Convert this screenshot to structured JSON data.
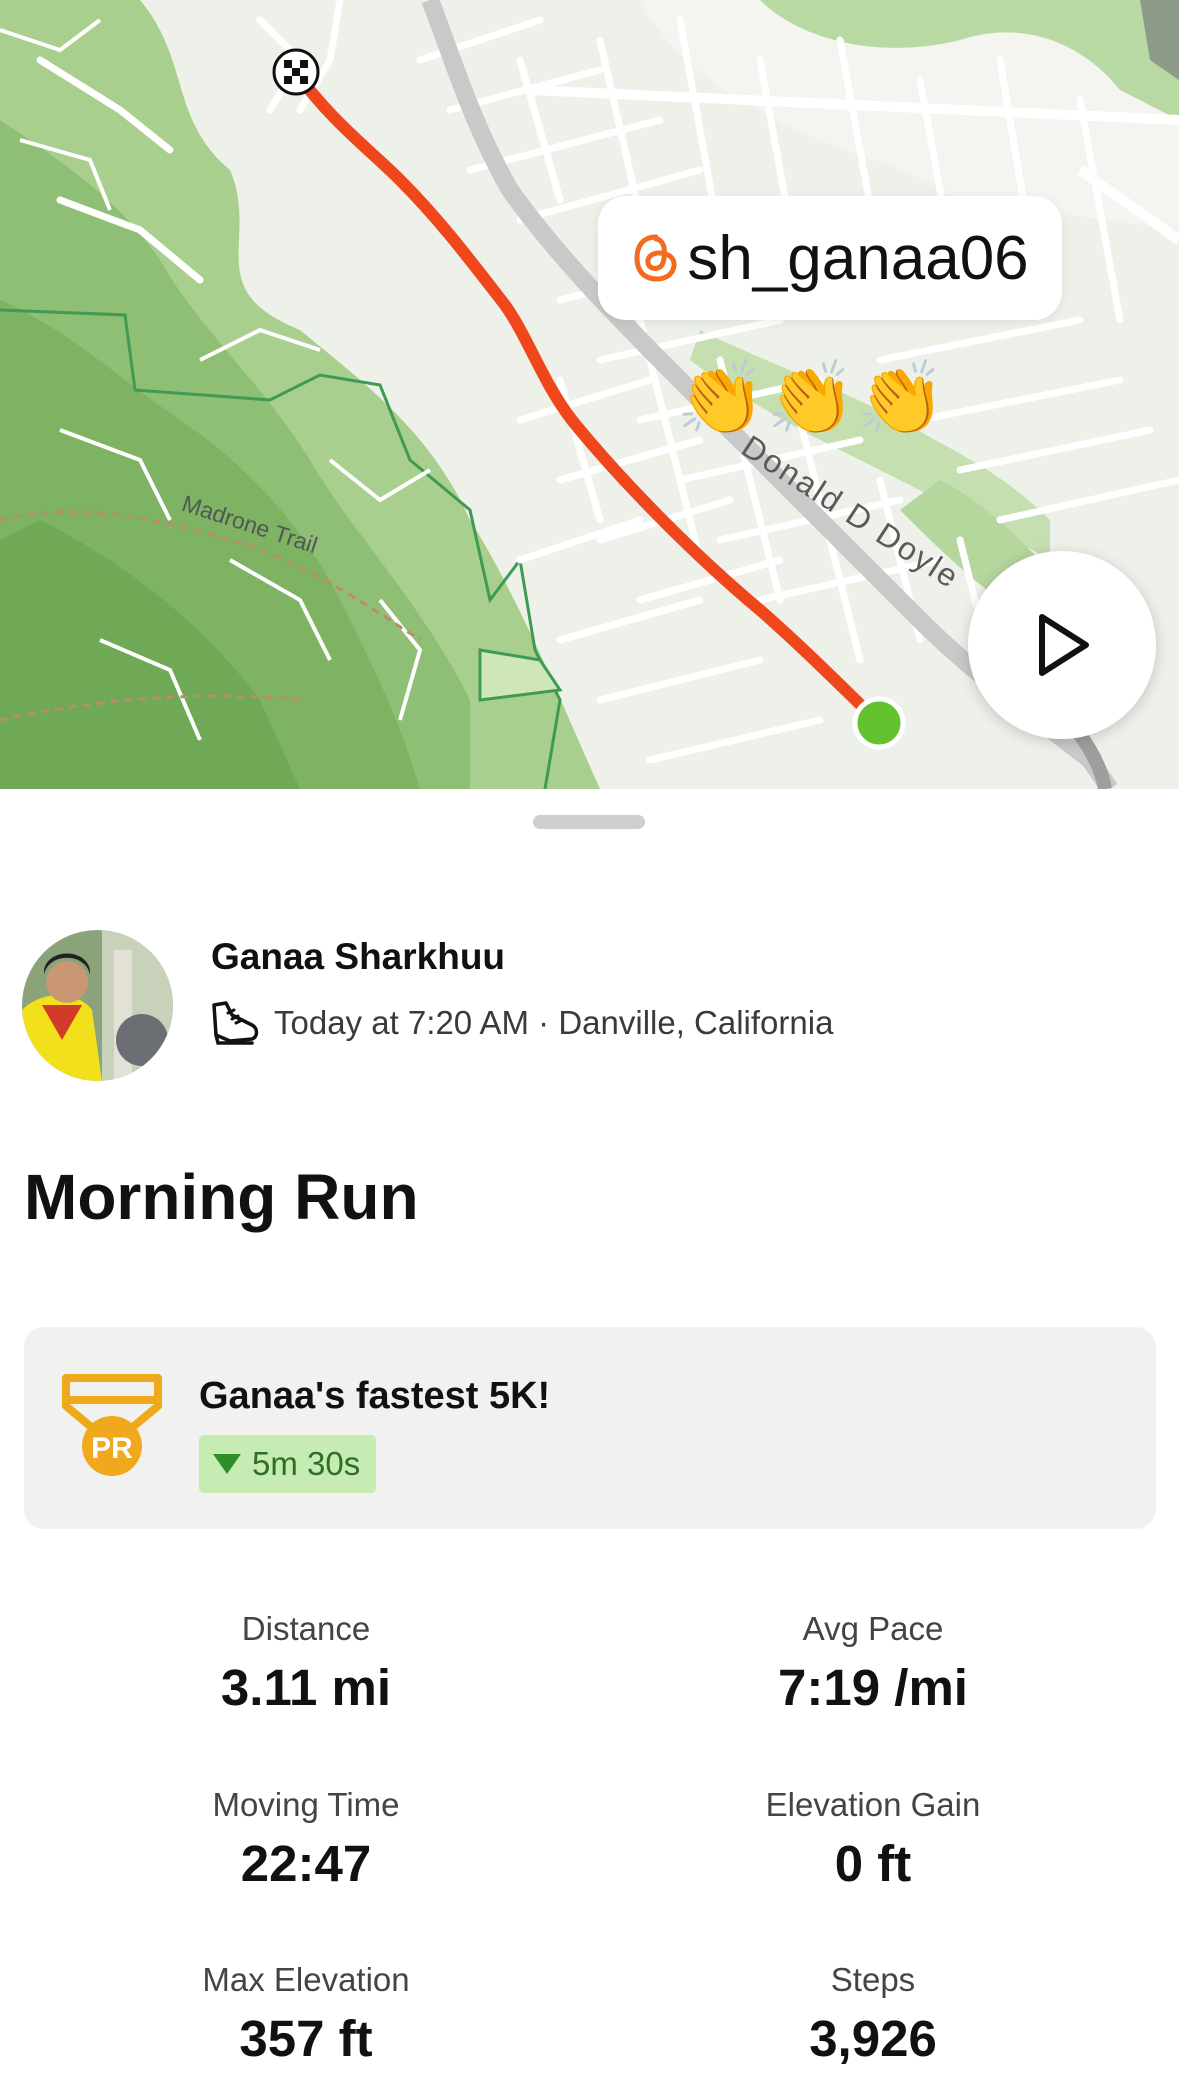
{
  "map": {
    "watermark_handle": "sh_ganaa06",
    "road_label": "Donald D Doyle",
    "trail_label": "Madrone Trail",
    "clap_emoji": "👏",
    "route_color": "#f0461c",
    "start_color": "#63c22d",
    "icons": {
      "finish": "checkered-flag-icon",
      "start": "green-dot-icon",
      "play": "play-icon",
      "watermark": "threads-icon"
    }
  },
  "athlete": {
    "name": "Ganaa Sharkhuu",
    "meta": "Today at 7:20 AM · Danville, California",
    "activity_icon": "running-shoe-icon"
  },
  "activity": {
    "title": "Morning Run"
  },
  "achievement": {
    "icon": "pr-medal-icon",
    "icon_text": "PR",
    "title": "Ganaa's fastest 5K!",
    "delta": "5m 30s",
    "delta_icon": "down-triangle-icon"
  },
  "stats": [
    {
      "label": "Distance",
      "value": "3.11 mi"
    },
    {
      "label": "Avg Pace",
      "value": "7:19 /mi"
    },
    {
      "label": "Moving Time",
      "value": "22:47"
    },
    {
      "label": "Elevation Gain",
      "value": "0 ft"
    },
    {
      "label": "Max Elevation",
      "value": "357 ft"
    },
    {
      "label": "Steps",
      "value": "3,926"
    }
  ],
  "colors": {
    "accent": "#fc4c02",
    "pr_gold": "#f0a81c",
    "pr_badge_bg": "#c6ecb3",
    "pr_badge_text": "#2f6e27"
  }
}
